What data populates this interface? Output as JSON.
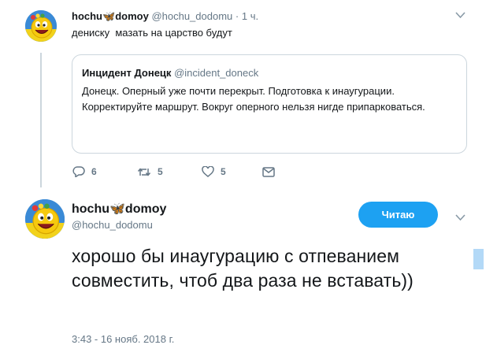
{
  "tweet1": {
    "display_name": "hochu",
    "display_name_suffix": "domoy",
    "handle": "@hochu_dodomu",
    "separator": "·",
    "time": "1 ч.",
    "text": "дениску  мазать на царство будут",
    "quoted": {
      "display_name": "Инцидент Донецк",
      "handle": "@incident_doneck",
      "text": "Донецк. Оперный уже почти перекрыт. Подготовка к инаугурации. Корректируйте маршрут. Вокруг оперного нельзя нигде припарковаться."
    },
    "actions": {
      "replies": "6",
      "retweets": "5",
      "likes": "5"
    }
  },
  "tweet2": {
    "display_name": "hochu",
    "display_name_suffix": "domoy",
    "handle": "@hochu_dodomu",
    "follow_button": "Читаю",
    "text": "хорошо бы инаугурацию с отпеванием совместить, чтоб два раза не вставать))",
    "timestamp": "3:43 - 16 нояб. 2018 г."
  },
  "colors": {
    "accent": "#1da1f2",
    "muted": "#657786",
    "border": "#ccd6dd"
  },
  "icons": [
    "butterfly-icon",
    "chevron-down-icon",
    "reply-icon",
    "retweet-icon",
    "like-icon",
    "dm-icon"
  ]
}
